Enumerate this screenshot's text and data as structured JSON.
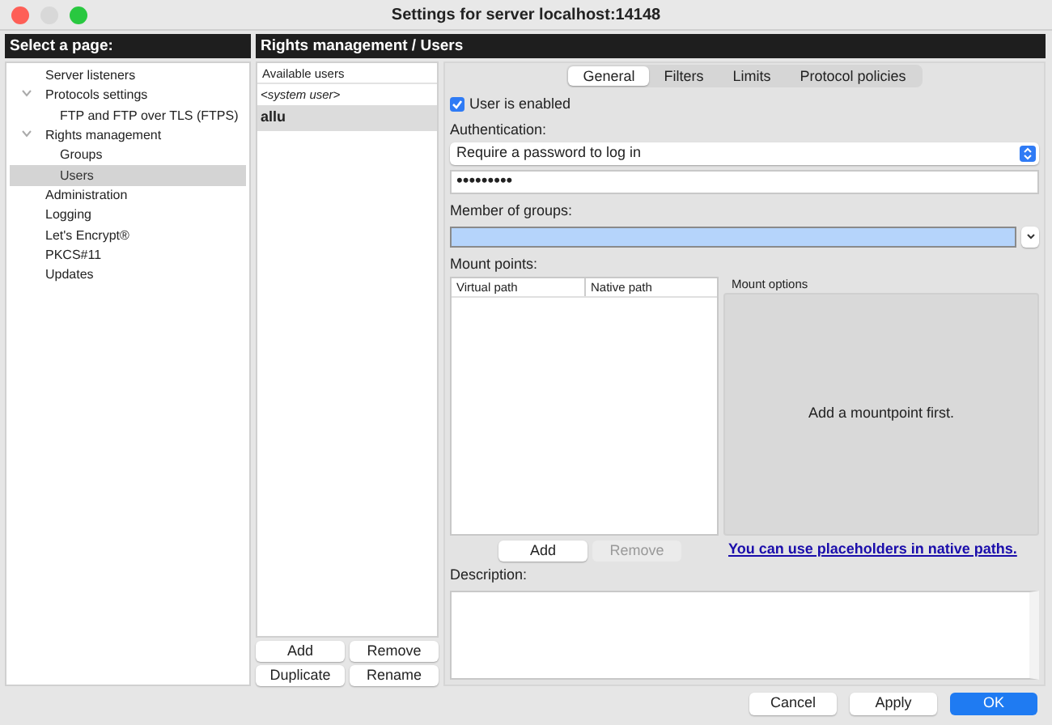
{
  "window": {
    "title": "Settings for server localhost:14148"
  },
  "sidebar": {
    "header": "Select a page:",
    "items": [
      {
        "label": "Server listeners",
        "selected": false
      },
      {
        "label": "Protocols settings",
        "selected": false,
        "expanded": true,
        "children": [
          {
            "label": "FTP and FTP over TLS (FTPS)",
            "selected": false
          }
        ]
      },
      {
        "label": "Rights management",
        "selected": false,
        "expanded": true,
        "children": [
          {
            "label": "Groups",
            "selected": false
          },
          {
            "label": "Users",
            "selected": true
          }
        ]
      },
      {
        "label": "Administration",
        "selected": false
      },
      {
        "label": "Logging",
        "selected": false
      },
      {
        "label": "Let's Encrypt®",
        "selected": false
      },
      {
        "label": "PKCS#11",
        "selected": false
      },
      {
        "label": "Updates",
        "selected": false
      }
    ]
  },
  "content_header": "Rights management / Users",
  "users": {
    "column": "Available users",
    "rows": [
      {
        "name": "<system user>",
        "kind": "system",
        "selected": false
      },
      {
        "name": "allu",
        "kind": "user",
        "selected": true
      }
    ],
    "buttons": [
      {
        "label": "Add"
      },
      {
        "label": "Remove"
      },
      {
        "label": "Duplicate"
      },
      {
        "label": "Rename"
      }
    ]
  },
  "tabs": [
    {
      "label": "General",
      "selected": true
    },
    {
      "label": "Filters",
      "selected": false
    },
    {
      "label": "Limits",
      "selected": false
    },
    {
      "label": "Protocol policies",
      "selected": false
    }
  ],
  "general": {
    "enabled": {
      "label": "User is enabled",
      "checked": true
    },
    "authentication": {
      "label": "Authentication:",
      "value": "Require a password to log in"
    },
    "password": "•••••••••",
    "groups": {
      "label": "Member of groups:"
    },
    "mount_points": {
      "label": "Mount points:",
      "columns": [
        "Virtual path",
        "Native path"
      ],
      "options_label": "Mount options",
      "empty_message": "Add a mountpoint first.",
      "buttons": [
        {
          "label": "Add",
          "disabled": false
        },
        {
          "label": "Remove",
          "disabled": true
        }
      ],
      "link": "You can use placeholders in native paths."
    },
    "description": {
      "label": "Description:"
    }
  },
  "footer_buttons": [
    {
      "label": "Cancel",
      "default": false
    },
    {
      "label": "Apply",
      "default": false
    },
    {
      "label": "OK",
      "default": true
    }
  ]
}
